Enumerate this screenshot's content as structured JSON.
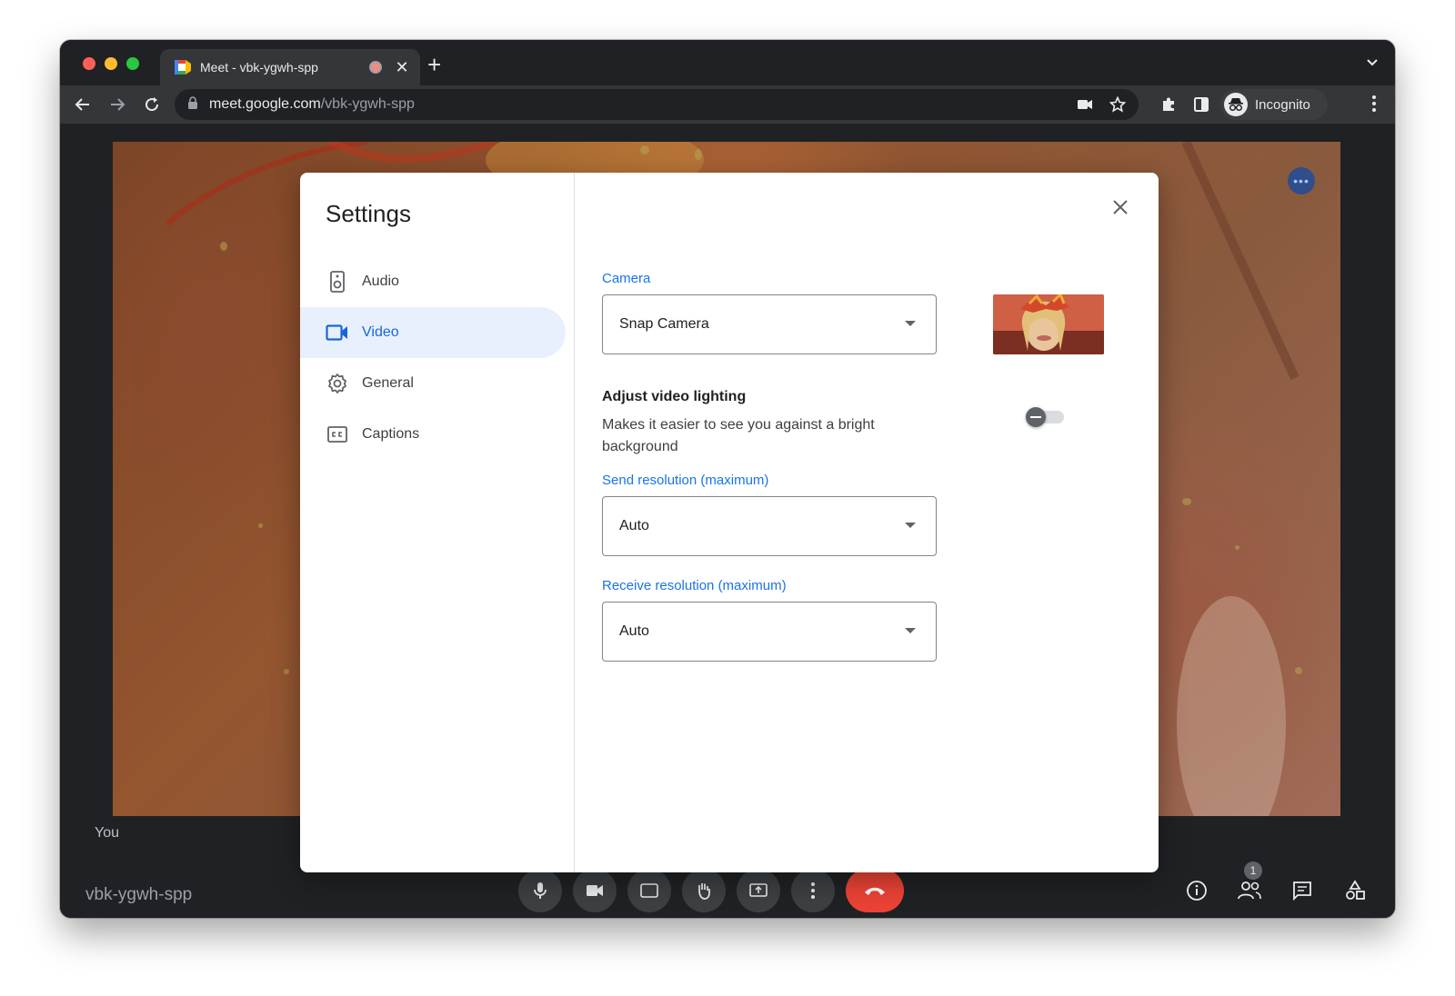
{
  "browser": {
    "tab": {
      "title": "Meet - vbk-ygwh-spp",
      "close": "✕"
    },
    "new_tab": "+",
    "url": {
      "host": "meet.google.com",
      "path": "/vbk-ygwh-spp"
    },
    "profile_label": "Incognito"
  },
  "meet": {
    "you_label": "You",
    "meeting_code": "vbk-ygwh-spp",
    "participants_count": "1"
  },
  "settings": {
    "title": "Settings",
    "nav": [
      {
        "label": "Audio"
      },
      {
        "label": "Video"
      },
      {
        "label": "General"
      },
      {
        "label": "Captions"
      }
    ],
    "active_nav": "Video",
    "camera_label": "Camera",
    "camera_value": "Snap Camera",
    "lighting_title": "Adjust video lighting",
    "lighting_desc": "Makes it easier to see you against a bright background",
    "lighting_enabled": false,
    "send_label": "Send resolution (maximum)",
    "send_value": "Auto",
    "receive_label": "Receive resolution (maximum)",
    "receive_value": "Auto"
  },
  "colors": {
    "accent": "#1a73e8",
    "active_nav_bg": "#e8f0fe",
    "end_call": "#ea4335"
  }
}
